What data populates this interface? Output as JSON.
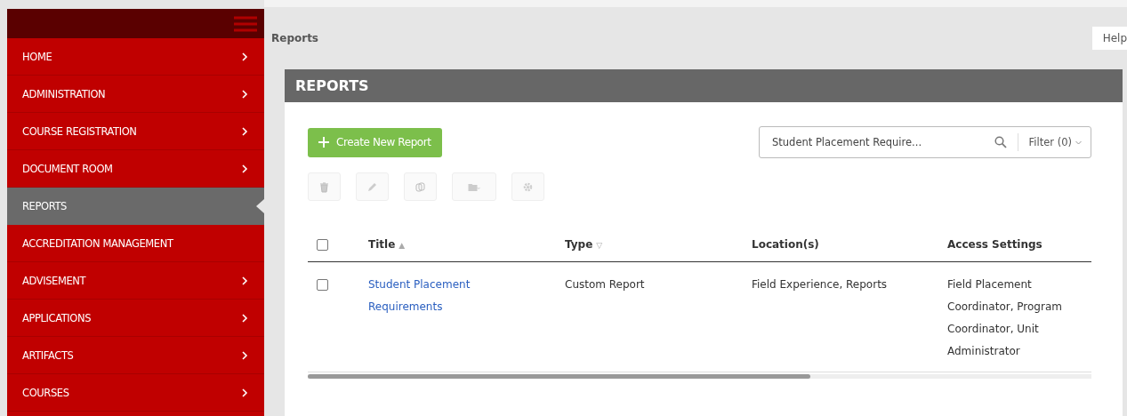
{
  "sidebar": {
    "items": [
      {
        "label": "HOME",
        "expandable": true,
        "selected": false
      },
      {
        "label": "ADMINISTRATION",
        "expandable": true,
        "selected": false
      },
      {
        "label": "COURSE REGISTRATION",
        "expandable": true,
        "selected": false
      },
      {
        "label": "DOCUMENT ROOM",
        "expandable": true,
        "selected": false
      },
      {
        "label": "REPORTS",
        "expandable": false,
        "selected": true
      },
      {
        "label": "ACCREDITATION MANAGEMENT",
        "expandable": false,
        "selected": false
      },
      {
        "label": "ADVISEMENT",
        "expandable": true,
        "selected": false
      },
      {
        "label": "APPLICATIONS",
        "expandable": true,
        "selected": false
      },
      {
        "label": "ARTIFACTS",
        "expandable": true,
        "selected": false
      },
      {
        "label": "COURSES",
        "expandable": true,
        "selected": false
      }
    ]
  },
  "breadcrumb": "Reports",
  "help": "Help",
  "panel": {
    "title": "REPORTS",
    "create_button": "Create New Report",
    "search": {
      "value": "Student Placement Require...",
      "filter": "Filter (0)"
    },
    "table": {
      "select_all_checked": false,
      "columns": [
        {
          "label": "Title",
          "sort_mark": "▲"
        },
        {
          "label": "Type",
          "sort_mark": "▽"
        },
        {
          "label": "Location(s)"
        },
        {
          "label": "Access Settings"
        }
      ],
      "rows": [
        {
          "checked": false,
          "cells": [
            "Student Placement Requirements",
            "Custom Report",
            "Field Experience, Reports",
            "Field Placement Coordinator, Program Coordinator, Unit Administrator"
          ]
        }
      ]
    }
  }
}
